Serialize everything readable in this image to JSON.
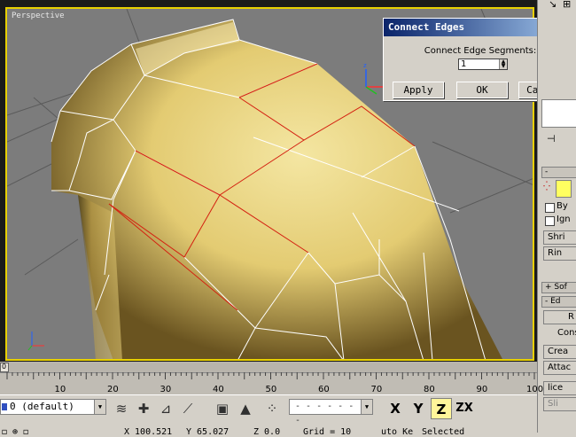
{
  "viewport": {
    "label": "Perspective"
  },
  "dialog": {
    "title": "Connect Edges",
    "close_icon": "close-icon",
    "segments_label": "Connect Edge Segments:",
    "segments_value": "1",
    "apply_label": "Apply",
    "ok_label": "OK",
    "cancel_label": "Cancel"
  },
  "command_panel": {
    "selection_head": "-",
    "by_label": "By",
    "ign_label": "Ign",
    "shrink_label": "Shri",
    "ring_label": "Rin",
    "soft_head": "+ Sof",
    "edit_head": "- Ed",
    "r_label": "R",
    "const_label": "Const",
    "crea_label": "Crea",
    "attach_label": "Attac",
    "slice_label": "lice",
    "sli_label": "Sli"
  },
  "ruler": {
    "ticks": [
      "10",
      "20",
      "30",
      "40",
      "50",
      "60",
      "70",
      "80",
      "90",
      "100"
    ],
    "frame_display": "0"
  },
  "toolbar": {
    "layer_label": "0 (default)",
    "selection_set": "",
    "axis_x": "X",
    "axis_y": "Y",
    "axis_z": "Z",
    "axis_zx": "ZX",
    "coord_x": "X 100.521",
    "coord_y": "Y 65.027",
    "coord_z": "Z 0.0",
    "grid_label": "Grid = 10",
    "autokey_label": "uto Ke",
    "selected_label": "Selected"
  },
  "colors": {
    "accent": "#0a246a",
    "model_fill": "#e8d27a",
    "viewport_border": "#e8d000",
    "selected_edge": "#d42010"
  }
}
